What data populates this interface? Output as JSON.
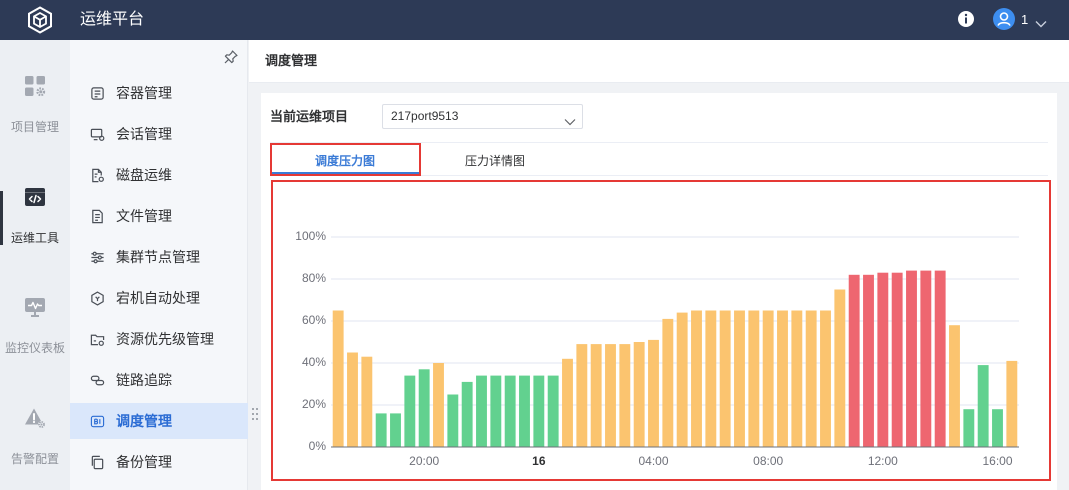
{
  "app": {
    "title": "运维平台",
    "logo_icon": "cube-logo-icon"
  },
  "header": {
    "info_icon": "info-icon",
    "avatar_icon": "user-avatar-icon",
    "user_name": "1",
    "menu_icon": "chevron-down-icon"
  },
  "rail": {
    "items": [
      {
        "label": "项目管理",
        "icon": "grid-gear-icon",
        "active": false
      },
      {
        "label": "运维工具",
        "icon": "code-window-icon",
        "active": true
      },
      {
        "label": "监控仪表板",
        "icon": "monitor-pulse-icon",
        "active": false
      },
      {
        "label": "告警配置",
        "icon": "alert-gear-icon",
        "active": false
      }
    ]
  },
  "sidebar": {
    "pin_icon": "pin-icon",
    "items": [
      {
        "label": "容器管理",
        "icon": "container-icon",
        "active": false
      },
      {
        "label": "会话管理",
        "icon": "session-monitor-icon",
        "active": false
      },
      {
        "label": "磁盘运维",
        "icon": "disk-doc-icon",
        "active": false
      },
      {
        "label": "文件管理",
        "icon": "file-list-icon",
        "active": false
      },
      {
        "label": "集群节点管理",
        "icon": "sliders-icon",
        "active": false
      },
      {
        "label": "宕机自动处理",
        "icon": "auto-recover-icon",
        "active": false
      },
      {
        "label": "资源优先级管理",
        "icon": "folder-gear-icon",
        "active": false
      },
      {
        "label": "链路追踪",
        "icon": "link-icon",
        "active": false
      },
      {
        "label": "调度管理",
        "icon": "bi-report-icon",
        "active": true
      },
      {
        "label": "备份管理",
        "icon": "backup-copy-icon",
        "active": false
      }
    ]
  },
  "page": {
    "title": "调度管理"
  },
  "project": {
    "label": "当前运维项目",
    "value": "217port9513",
    "dropdown_icon": "chevron-down-icon"
  },
  "tabs": [
    {
      "label": "调度压力图",
      "active": true
    },
    {
      "label": "压力详情图",
      "active": false
    }
  ],
  "colors": {
    "header_bg": "#2d3a56",
    "accent": "#3b7bd6",
    "highlight_outline": "#e53935"
  },
  "chart_data": {
    "type": "bar",
    "x": [
      "17:00",
      "17:30",
      "18:00",
      "18:30",
      "19:00",
      "19:30",
      "20:00",
      "20:30",
      "21:00",
      "21:30",
      "22:00",
      "22:30",
      "23:00",
      "23:30",
      "00:00",
      "00:30",
      "01:00",
      "01:30",
      "02:00",
      "02:30",
      "03:00",
      "03:30",
      "04:00",
      "04:30",
      "05:00",
      "05:30",
      "06:00",
      "06:30",
      "07:00",
      "07:30",
      "08:00",
      "08:30",
      "09:00",
      "09:30",
      "10:00",
      "10:30",
      "11:00",
      "11:30",
      "12:00",
      "12:30",
      "13:00",
      "13:30",
      "14:00",
      "14:30",
      "15:00",
      "15:30",
      "16:00",
      "16:30"
    ],
    "values": [
      65,
      45,
      43,
      16,
      16,
      34,
      37,
      40,
      25,
      31,
      34,
      34,
      34,
      34,
      34,
      34,
      42,
      49,
      49,
      49,
      49,
      50,
      51,
      61,
      64,
      65,
      65,
      65,
      65,
      65,
      65,
      65,
      65,
      65,
      65,
      75,
      82,
      82,
      83,
      83,
      84,
      84,
      84,
      58,
      18,
      39,
      18,
      41
    ],
    "ylim": [
      0,
      100
    ],
    "y_ticks": [
      0,
      20,
      40,
      60,
      80,
      100
    ],
    "y_tick_labels": [
      "0%",
      "20%",
      "40%",
      "60%",
      "80%",
      "100%"
    ],
    "x_ticks": [
      {
        "x": "20:00",
        "label": "20:00"
      },
      {
        "x": "00:00",
        "label": "16"
      },
      {
        "x": "04:00",
        "label": "04:00"
      },
      {
        "x": "08:00",
        "label": "08:00"
      },
      {
        "x": "12:00",
        "label": "12:00"
      },
      {
        "x": "16:00",
        "label": "16:00"
      }
    ],
    "grid": true,
    "bar_colors": {
      "low": "#62d18f",
      "medium": "#fbc46f",
      "high": "#ee6670"
    }
  }
}
